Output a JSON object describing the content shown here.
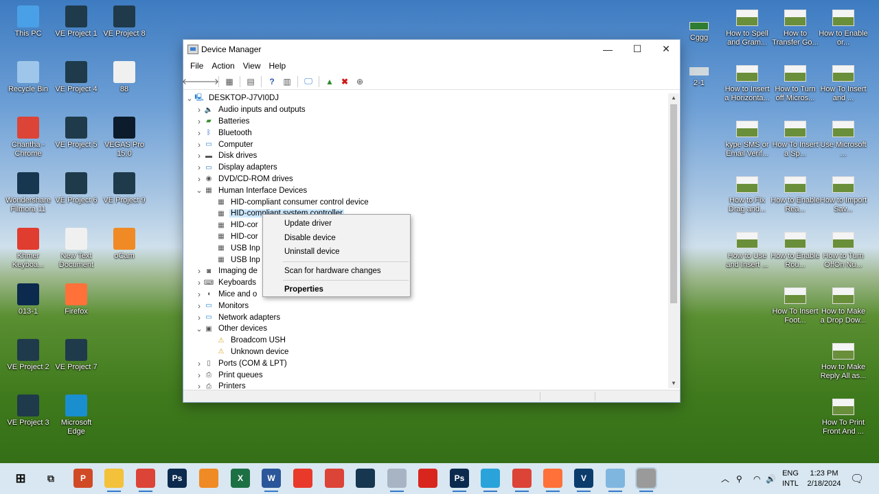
{
  "desktop": {
    "left_icons": [
      {
        "label": "This PC",
        "icon": "pc-icon",
        "color": "#4aa0e6"
      },
      {
        "label": "VE Project 1",
        "icon": "project-file-icon",
        "color": "#1f3a4a"
      },
      {
        "label": "VE Project 8",
        "icon": "project-file-icon",
        "color": "#1f3a4a"
      },
      {
        "label": "Recycle Bin",
        "icon": "recycle-bin-icon",
        "color": "#9ec6ea"
      },
      {
        "label": "VE Project 4",
        "icon": "project-file-icon",
        "color": "#1f3a4a"
      },
      {
        "label": "88",
        "icon": "text-file-icon",
        "color": "#f0f0f0"
      },
      {
        "label": "Chantha - Chrome",
        "icon": "chrome-icon",
        "color": "#db4437"
      },
      {
        "label": "VE Project 5",
        "icon": "project-file-icon",
        "color": "#1f3a4a"
      },
      {
        "label": "VEGAS Pro 15.0",
        "icon": "vegas-icon",
        "color": "#0c1c2c"
      },
      {
        "label": "Wondershare Filmora 11",
        "icon": "filmora-icon",
        "color": "#173650"
      },
      {
        "label": "VE Project 6",
        "icon": "project-file-icon",
        "color": "#1f3a4a"
      },
      {
        "label": "VE Project 9",
        "icon": "project-file-icon",
        "color": "#1f3a4a"
      },
      {
        "label": "Khmer Keyboa...",
        "icon": "pdf-icon",
        "color": "#e03c2f"
      },
      {
        "label": "New Text Document",
        "icon": "text-file-icon",
        "color": "#f0f0f0"
      },
      {
        "label": "oCam",
        "icon": "ocam-icon",
        "color": "#f08a24"
      },
      {
        "label": "013-1",
        "icon": "photoshop-icon",
        "color": "#0b2a4e"
      },
      {
        "label": "Firefox",
        "icon": "firefox-icon",
        "color": "#ff7139"
      },
      {
        "label": "VE Project 2",
        "icon": "project-file-icon",
        "color": "#1f3a4a"
      },
      {
        "label": "VE Project 7",
        "icon": "project-file-icon",
        "color": "#1f3a4a"
      },
      {
        "label": "VE Project 3",
        "icon": "project-file-icon",
        "color": "#1f3a4a"
      },
      {
        "label": "Microsoft Edge",
        "icon": "edge-icon",
        "color": "#1a8fcf"
      }
    ],
    "right_icons": [
      {
        "label": "Cggg"
      },
      {
        "label": "How to Spell and Gram..."
      },
      {
        "label": "How to Transfer Go..."
      },
      {
        "label": "How to Enable or..."
      },
      {
        "label": "2-1"
      },
      {
        "label": "How to Insert a Horizonta..."
      },
      {
        "label": "How to Turn off Micros..."
      },
      {
        "label": "How To Insert and ..."
      },
      {
        "label": "kype SMS or Email Verif..."
      },
      {
        "label": "How To Insert a Sp..."
      },
      {
        "label": "Use Microsoft ..."
      },
      {
        "label": "How to Fix Drag and..."
      },
      {
        "label": "How to Enable Rea..."
      },
      {
        "label": "How to Import Sav..."
      },
      {
        "label": "How to Use and Insert ..."
      },
      {
        "label": "How to Enable Rou..."
      },
      {
        "label": "How to Turn OffOn Nu..."
      },
      {
        "label": "How To Insert Foot..."
      },
      {
        "label": "How to Make a Drop Dow..."
      },
      {
        "label": "How to Make Reply All as..."
      },
      {
        "label": "How To Print Front And ..."
      }
    ]
  },
  "window": {
    "title": "Device Manager",
    "controls": {
      "minimize": "—",
      "maximize": "☐",
      "close": "✕"
    },
    "menu": [
      "File",
      "Action",
      "View",
      "Help"
    ],
    "tree": {
      "root": "DESKTOP-J7VI0DJ",
      "items": [
        {
          "label": "Audio inputs and outputs",
          "icon": "speaker-icon",
          "expanded": false,
          "level": 1
        },
        {
          "label": "Batteries",
          "icon": "battery-icon",
          "expanded": false,
          "level": 1
        },
        {
          "label": "Bluetooth",
          "icon": "bluetooth-icon",
          "expanded": false,
          "level": 1
        },
        {
          "label": "Computer",
          "icon": "monitor-icon",
          "expanded": false,
          "level": 1
        },
        {
          "label": "Disk drives",
          "icon": "disk-icon",
          "expanded": false,
          "level": 1
        },
        {
          "label": "Display adapters",
          "icon": "display-adapter-icon",
          "expanded": false,
          "level": 1
        },
        {
          "label": "DVD/CD-ROM drives",
          "icon": "dvd-icon",
          "expanded": false,
          "level": 1
        },
        {
          "label": "Human Interface Devices",
          "icon": "hid-icon",
          "expanded": true,
          "level": 1
        },
        {
          "label": "HID-compliant consumer control device",
          "icon": "hid-icon",
          "level": 2
        },
        {
          "label": "HID-compliant system controller",
          "icon": "hid-icon",
          "level": 2,
          "selected": true
        },
        {
          "label": "HID-cor",
          "icon": "hid-icon",
          "level": 2
        },
        {
          "label": "HID-cor",
          "icon": "hid-icon",
          "level": 2
        },
        {
          "label": "USB Inp",
          "icon": "hid-icon",
          "level": 2
        },
        {
          "label": "USB Inp",
          "icon": "hid-icon",
          "level": 2
        },
        {
          "label": "Imaging de",
          "icon": "camera-icon",
          "expanded": false,
          "level": 1
        },
        {
          "label": "Keyboards",
          "icon": "keyboard-icon",
          "expanded": false,
          "level": 1
        },
        {
          "label": "Mice and o",
          "icon": "mouse-icon",
          "expanded": false,
          "level": 1
        },
        {
          "label": "Monitors",
          "icon": "monitor-icon",
          "expanded": false,
          "level": 1
        },
        {
          "label": "Network adapters",
          "icon": "network-icon",
          "expanded": false,
          "level": 1
        },
        {
          "label": "Other devices",
          "icon": "unknown-device-icon",
          "expanded": true,
          "level": 1
        },
        {
          "label": "Broadcom USH",
          "icon": "warning-device-icon",
          "level": 2
        },
        {
          "label": "Unknown device",
          "icon": "warning-device-icon",
          "level": 2
        },
        {
          "label": "Ports (COM & LPT)",
          "icon": "port-icon",
          "expanded": false,
          "level": 1
        },
        {
          "label": "Print queues",
          "icon": "printer-icon",
          "expanded": false,
          "level": 1
        },
        {
          "label": "Printers",
          "icon": "printer-icon",
          "expanded": false,
          "level": 1
        }
      ]
    }
  },
  "context_menu": {
    "items": [
      {
        "label": "Update driver"
      },
      {
        "label": "Disable device"
      },
      {
        "label": "Uninstall device"
      },
      {
        "separator": true
      },
      {
        "label": "Scan for hardware changes"
      },
      {
        "separator": true
      },
      {
        "label": "Properties",
        "bold": true
      }
    ]
  },
  "taskbar": {
    "apps": [
      {
        "name": "powerpoint-icon",
        "glyph": "P",
        "color": "#d04a26"
      },
      {
        "name": "file-explorer-icon",
        "glyph": "",
        "color": "#f3c13a"
      },
      {
        "name": "chrome-icon",
        "glyph": "",
        "color": "#db4437"
      },
      {
        "name": "photoshop-icon",
        "glyph": "Ps",
        "color": "#0b2a4e"
      },
      {
        "name": "ocam-icon",
        "glyph": "",
        "color": "#f08a24"
      },
      {
        "name": "excel-icon",
        "glyph": "X",
        "color": "#1d7044"
      },
      {
        "name": "word-icon",
        "glyph": "W",
        "color": "#2b579a"
      },
      {
        "name": "anydesk-icon",
        "glyph": "",
        "color": "#e8392b"
      },
      {
        "name": "chrome-icon",
        "glyph": "",
        "color": "#db4437"
      },
      {
        "name": "filmora-icon",
        "glyph": "",
        "color": "#173650"
      },
      {
        "name": "paint-icon",
        "glyph": "",
        "color": "#a8b4c4"
      },
      {
        "name": "pdf-icon",
        "glyph": "",
        "color": "#d8261e"
      },
      {
        "name": "photoshop-icon",
        "glyph": "Ps",
        "color": "#0b2a4e"
      },
      {
        "name": "telegram-icon",
        "glyph": "",
        "color": "#2aa3da"
      },
      {
        "name": "chrome-icon",
        "glyph": "",
        "color": "#db4437"
      },
      {
        "name": "firefox-icon",
        "glyph": "",
        "color": "#ff7139"
      },
      {
        "name": "vegas-icon",
        "glyph": "V",
        "color": "#0c3c6c"
      },
      {
        "name": "notepad-icon",
        "glyph": "",
        "color": "#7fb6e0"
      },
      {
        "name": "device-manager-icon",
        "glyph": "",
        "color": "#9a9a9a"
      }
    ],
    "lang_top": "ENG",
    "lang_bottom": "INTL",
    "time": "1:23 PM",
    "date": "2/18/2024"
  }
}
